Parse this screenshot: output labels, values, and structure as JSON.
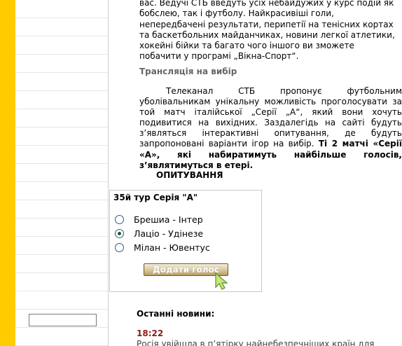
{
  "article": {
    "intro_lines": [
      "вас. Ведучі СТБ введуть усіх небайдужих у курс подій як",
      "бобслею, так і футболу. Найкрасивіші голи,",
      "непередбачені результати, перипетії на тенісних кортах",
      "та баскетбольних майданчиках, новини легкої атлетики,",
      "хокейні бійки та багато чого іншого ви зможете",
      "побачити у програмі „Вікна-Спорт“."
    ],
    "section_heading": "Трансляція на вибір",
    "para2_normal": "Телеканал СТБ пропонує футбольним уболівальникам унікальну можливість проголосувати за той матч італійської „Серії „А“, який вони хочуть подивитися на вихідних. Заздалегідь на сайті будуть з’являться інтерактивні опитування, де будуть запропоновані варіанти ігор на вибір.",
    "para2_bold": "Ті 2 матчі «Серії «А», які набиратимуть найбільше голосів, з’являтимуться в етері."
  },
  "poll": {
    "title": "ОПИТУВАННЯ",
    "question": "35й тур Серія \"А\"",
    "options": [
      {
        "label": "Брешиа - Інтер",
        "checked": false
      },
      {
        "label": "Лаціо - Удінезе",
        "checked": true
      },
      {
        "label": "Мілан - Ювентус",
        "checked": false
      }
    ],
    "vote_label": "Додати голос"
  },
  "news": {
    "heading": "Останні новини:",
    "time": "18:22",
    "text": "Росія увійшла в п’ятірку найнебезпечніших країн для"
  },
  "colors": {
    "sidebar_yellow": "#ffcc00",
    "section_gray": "#666666",
    "news_time": "#8b1a1a"
  }
}
